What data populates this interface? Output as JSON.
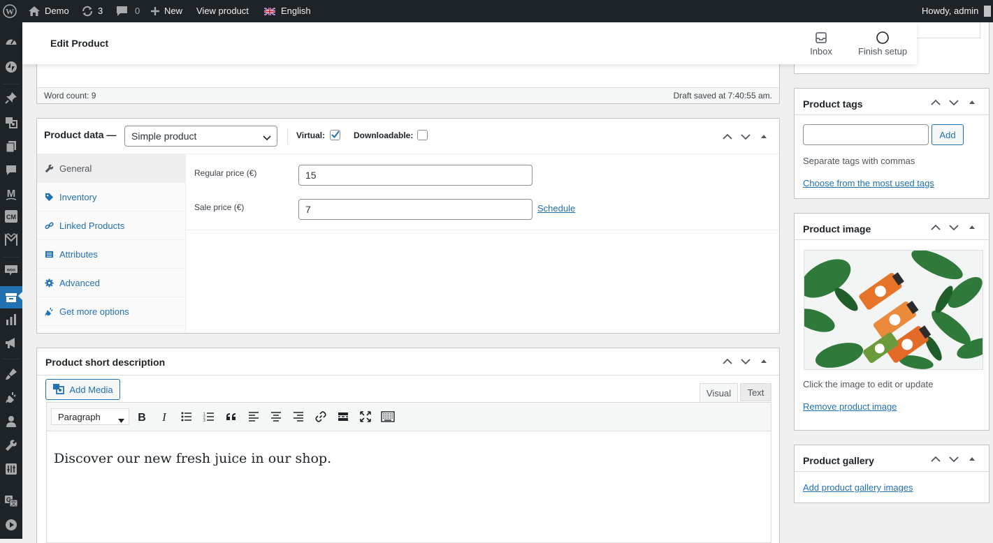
{
  "adminbar": {
    "site_name": "Demo",
    "updates_count": "3",
    "comments_count": "0",
    "new_label": "New",
    "view_product_label": "View product",
    "language_label": "English",
    "howdy_label": "Howdy, admin"
  },
  "header": {
    "title": "Edit Product",
    "inbox_label": "Inbox",
    "finish_setup_label": "Finish setup"
  },
  "editor_status": {
    "word_count": "Word count: 9",
    "draft_saved": "Draft saved at 7:40:55 am."
  },
  "product_data": {
    "title": "Product data —",
    "type_selected": "Simple product",
    "virtual_label": "Virtual:",
    "virtual_checked": true,
    "downloadable_label": "Downloadable:",
    "downloadable_checked": false,
    "tabs": [
      {
        "label": "General",
        "icon": "wrench-icon"
      },
      {
        "label": "Inventory",
        "icon": "tag-icon"
      },
      {
        "label": "Linked Products",
        "icon": "link-icon"
      },
      {
        "label": "Attributes",
        "icon": "list-icon"
      },
      {
        "label": "Advanced",
        "icon": "gear-icon"
      },
      {
        "label": "Get more options",
        "icon": "plugin-icon"
      }
    ],
    "regular_price_label": "Regular price (€)",
    "regular_price_value": "15",
    "sale_price_label": "Sale price (€)",
    "sale_price_value": "7",
    "schedule_label": "Schedule"
  },
  "short_description": {
    "title": "Product short description",
    "add_media_label": "Add Media",
    "visual_tab": "Visual",
    "text_tab": "Text",
    "format_selected": "Paragraph",
    "content": "Discover our new fresh juice in our shop."
  },
  "product_tags": {
    "title": "Product tags",
    "add_label": "Add",
    "input_value": "",
    "hint": "Separate tags with commas",
    "choose_link": "Choose from the most used tags"
  },
  "product_image": {
    "title": "Product image",
    "hint": "Click the image to edit or update",
    "remove_link": "Remove product image"
  },
  "product_gallery": {
    "title": "Product gallery",
    "add_link": "Add product gallery images"
  },
  "colors": {
    "adminbar_bg": "#1d2327",
    "accent": "#2271b1",
    "page_bg": "#f0f0f1"
  }
}
